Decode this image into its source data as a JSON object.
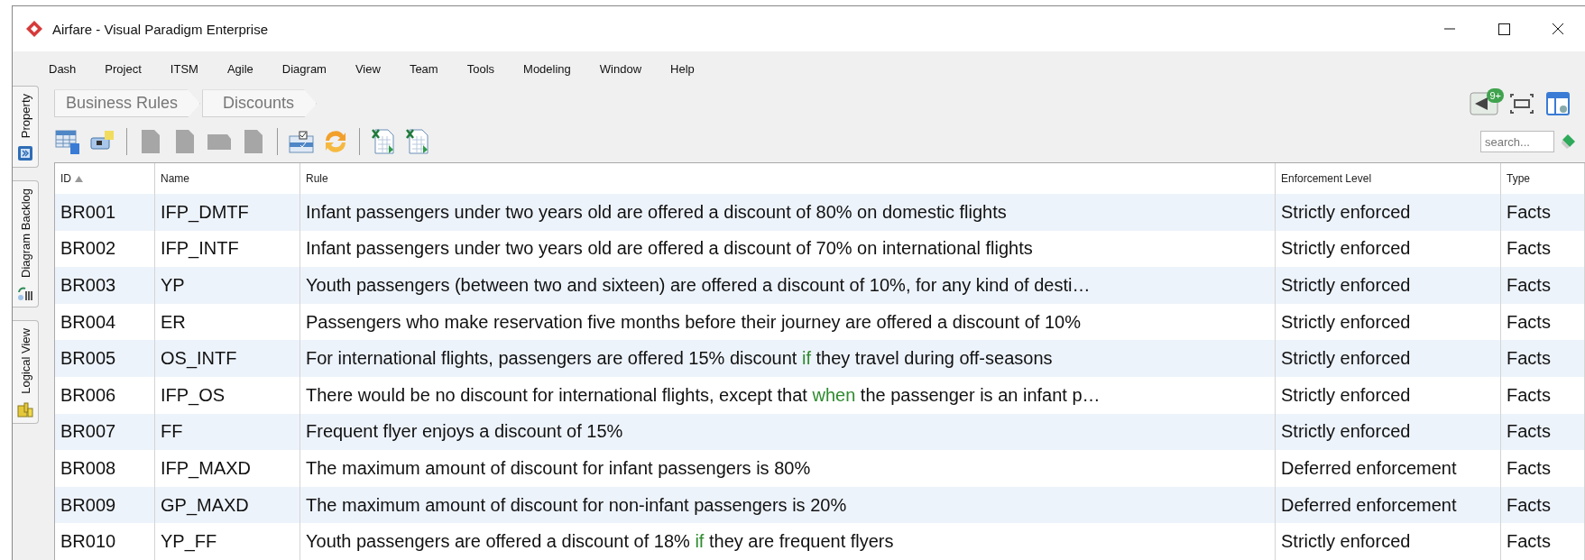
{
  "window": {
    "title": "Airfare - Visual Paradigm Enterprise"
  },
  "menu": [
    "Dash",
    "Project",
    "ITSM",
    "Agile",
    "Diagram",
    "View",
    "Team",
    "Tools",
    "Modeling",
    "Window",
    "Help"
  ],
  "side_tabs": [
    "Property",
    "Diagram Backlog",
    "Logical View"
  ],
  "breadcrumb": [
    "Business Rules",
    "Discounts"
  ],
  "notification_badge": "9+",
  "toolbar": [
    {
      "disabled": false
    },
    {
      "disabled": false
    },
    {
      "disabled": true
    },
    {
      "disabled": true
    },
    {
      "disabled": true
    },
    {
      "disabled": true
    },
    {
      "disabled": false
    },
    {
      "disabled": false
    },
    {
      "disabled": false
    },
    {
      "disabled": false
    }
  ],
  "search": {
    "placeholder": "search..."
  },
  "table": {
    "columns": [
      {
        "label": "ID",
        "sorted": true
      },
      {
        "label": "Name",
        "sorted": false
      },
      {
        "label": "Rule",
        "sorted": false
      },
      {
        "label": "Enforcement Level",
        "sorted": false
      },
      {
        "label": "Type",
        "sorted": false
      }
    ],
    "rows": [
      {
        "id": "BR001",
        "name": "IFP_DMTF",
        "rule": [
          {
            "text": "Infant passengers under two years old are offered a discount of 80% on domestic flights",
            "keyword": false
          }
        ],
        "enforcement": "Strictly enforced",
        "type": "Facts"
      },
      {
        "id": "BR002",
        "name": "IFP_INTF",
        "rule": [
          {
            "text": "Infant passengers under two years old are offered a discount of 70% on international flights",
            "keyword": false
          }
        ],
        "enforcement": "Strictly enforced",
        "type": "Facts"
      },
      {
        "id": "BR003",
        "name": "YP",
        "rule": [
          {
            "text": "Youth passengers (between two and sixteen) are offered a discount of 10%, for any kind of desti…",
            "keyword": false
          }
        ],
        "enforcement": "Strictly enforced",
        "type": "Facts"
      },
      {
        "id": "BR004",
        "name": "ER",
        "rule": [
          {
            "text": "Passengers who make reservation five months before their journey are offered a discount of 10%",
            "keyword": false
          }
        ],
        "enforcement": "Strictly enforced",
        "type": "Facts"
      },
      {
        "id": "BR005",
        "name": "OS_INTF",
        "rule": [
          {
            "text": "For international flights, passengers are offered 15% discount ",
            "keyword": false
          },
          {
            "text": "if",
            "keyword": true
          },
          {
            "text": " they travel during off-seasons",
            "keyword": false
          }
        ],
        "enforcement": "Strictly enforced",
        "type": "Facts"
      },
      {
        "id": "BR006",
        "name": "IFP_OS",
        "rule": [
          {
            "text": "There would be no discount for international flights, except that ",
            "keyword": false
          },
          {
            "text": "when",
            "keyword": true
          },
          {
            "text": " the passenger is an infant p…",
            "keyword": false
          }
        ],
        "enforcement": "Strictly enforced",
        "type": "Facts"
      },
      {
        "id": "BR007",
        "name": "FF",
        "rule": [
          {
            "text": "Frequent flyer enjoys a discount of 15%",
            "keyword": false
          }
        ],
        "enforcement": "Strictly enforced",
        "type": "Facts"
      },
      {
        "id": "BR008",
        "name": "IFP_MAXD",
        "rule": [
          {
            "text": "The maximum amount of discount for infant passengers is 80%",
            "keyword": false
          }
        ],
        "enforcement": "Deferred enforcement",
        "type": "Facts"
      },
      {
        "id": "BR009",
        "name": "GP_MAXD",
        "rule": [
          {
            "text": "The maximum amount of discount for non-infant passengers is 20%",
            "keyword": false
          }
        ],
        "enforcement": "Deferred enforcement",
        "type": "Facts"
      },
      {
        "id": "BR010",
        "name": "YP_FF",
        "rule": [
          {
            "text": "Youth passengers are offered a discount of 18% ",
            "keyword": false
          },
          {
            "text": "if",
            "keyword": true
          },
          {
            "text": " they are frequent flyers",
            "keyword": false
          }
        ],
        "enforcement": "Strictly enforced",
        "type": "Facts"
      }
    ]
  }
}
